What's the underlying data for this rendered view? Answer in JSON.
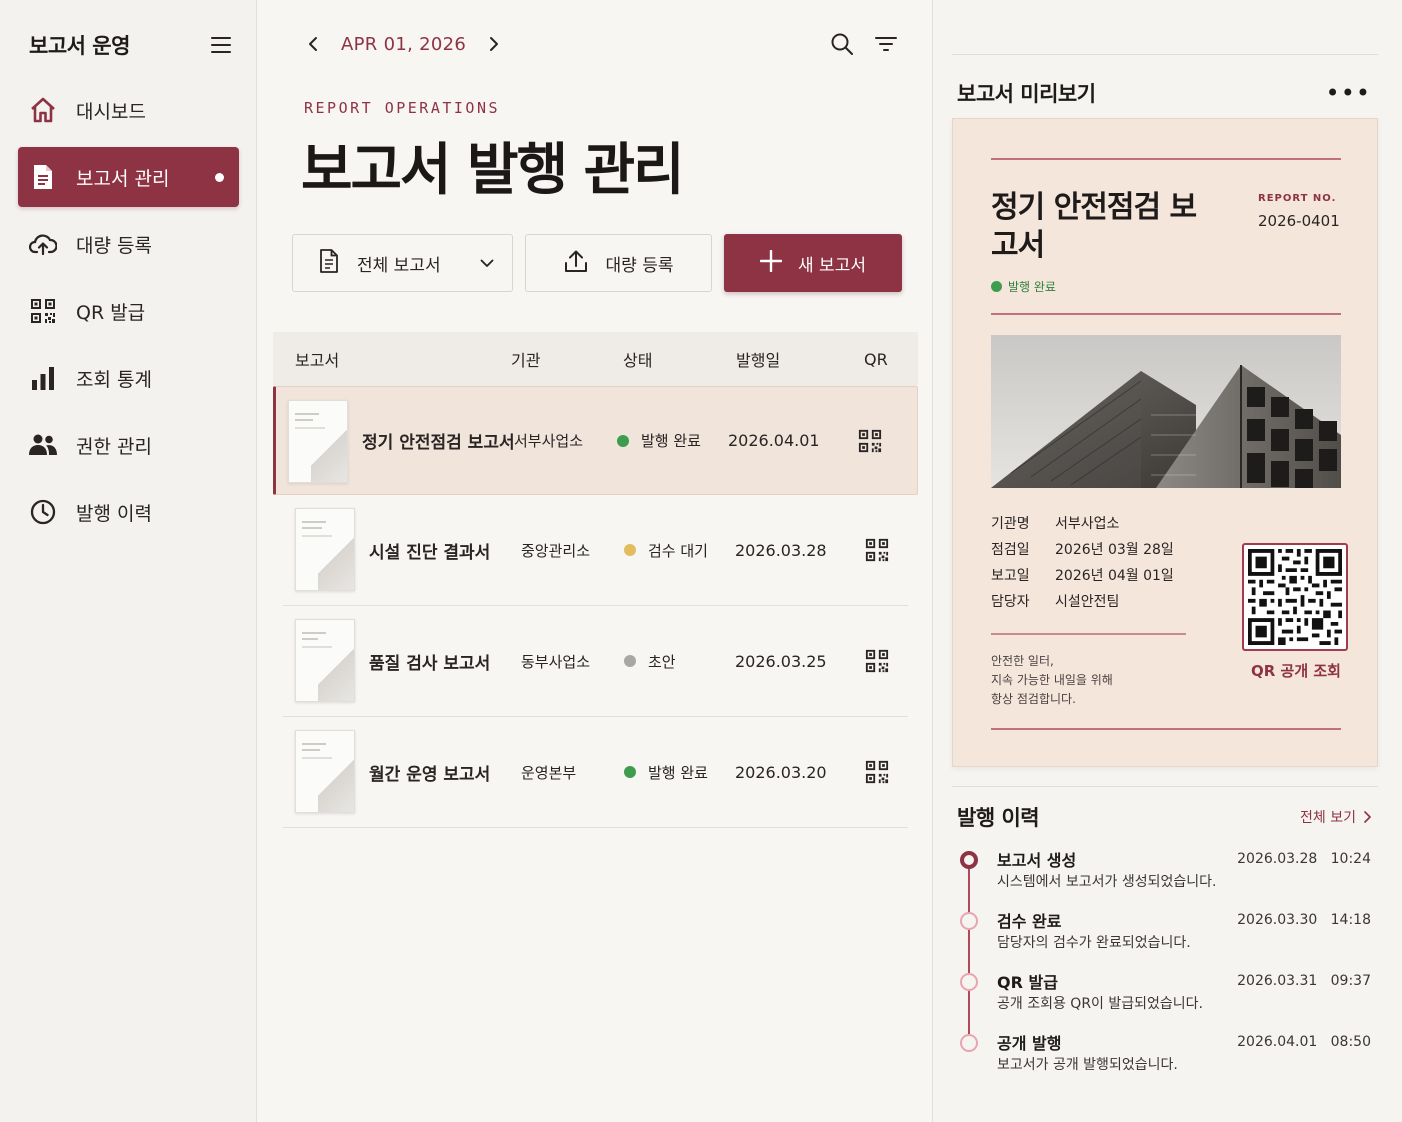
{
  "app": {
    "title": "보고서 운영"
  },
  "sidebar": {
    "items": [
      {
        "label": "대시보드",
        "icon": "home-icon",
        "active": false
      },
      {
        "label": "보고서 관리",
        "icon": "document-icon",
        "active": true
      },
      {
        "label": "대량 등록",
        "icon": "cloud-upload-icon",
        "active": false
      },
      {
        "label": "QR 발급",
        "icon": "qr-code-icon",
        "active": false
      },
      {
        "label": "조회 통계",
        "icon": "bar-chart-icon",
        "active": false
      },
      {
        "label": "권한 관리",
        "icon": "users-icon",
        "active": false
      },
      {
        "label": "발행 이력",
        "icon": "clock-icon",
        "active": false
      }
    ]
  },
  "main": {
    "date": "APR 01, 2026",
    "eyebrow": "REPORT OPERATIONS",
    "title": "보고서 발행 관리",
    "filter_label": "전체 보고서",
    "bulk_label": "대량 등록",
    "new_label": "새 보고서",
    "columns": [
      "보고서",
      "기관",
      "상태",
      "발행일",
      "QR"
    ],
    "rows": [
      {
        "name": "정기 안전점검 보고서",
        "org": "서부사업소",
        "status": "발행 완료",
        "status_color": "#3d9c4d",
        "date": "2026.04.01",
        "selected": true
      },
      {
        "name": "시설 진단 결과서",
        "org": "중앙관리소",
        "status": "검수 대기",
        "status_color": "#e2bc5e",
        "date": "2026.03.28",
        "selected": false
      },
      {
        "name": "품질 검사 보고서",
        "org": "동부사업소",
        "status": "초안",
        "status_color": "#a9a7a5",
        "date": "2026.03.25",
        "selected": false
      },
      {
        "name": "월간 운영 보고서",
        "org": "운영본부",
        "status": "발행 완료",
        "status_color": "#3d9c4d",
        "date": "2026.03.20",
        "selected": false
      }
    ]
  },
  "preview": {
    "title": "보고서 미리보기",
    "card_title": "정기 안전점검 보고서",
    "report_no_label": "REPORT NO.",
    "report_no": "2026-0401",
    "status": "발행 완료",
    "meta": [
      {
        "k": "기관명",
        "v": "서부사업소"
      },
      {
        "k": "점검일",
        "v": "2026년 03월 28일"
      },
      {
        "k": "보고일",
        "v": "2026년 04월 01일"
      },
      {
        "k": "담당자",
        "v": "시설안전팀"
      }
    ],
    "slogan": [
      "안전한 일터,",
      "지속 가능한 내일을 위해",
      "항상 점검합니다."
    ],
    "qr_label": "QR 공개 조회"
  },
  "history": {
    "title": "발행 이력",
    "view_all": "전체 보기",
    "items": [
      {
        "title": "보고서 생성",
        "desc": "시스템에서 보고서가 생성되었습니다.",
        "time": "2026.03.28   10:24"
      },
      {
        "title": "검수 완료",
        "desc": "담당자의 검수가 완료되었습니다.",
        "time": "2026.03.30   14:18"
      },
      {
        "title": "QR 발급",
        "desc": "공개 조회용 QR이 발급되었습니다.",
        "time": "2026.03.31   09:37"
      },
      {
        "title": "공개 발행",
        "desc": "보고서가 공개 발행되었습니다.",
        "time": "2026.04.01   08:50"
      }
    ]
  },
  "colors": {
    "accent": "#8e3344",
    "accent_soft": "#f1e4db",
    "success": "#3d9c4d",
    "pending": "#e2bc5e",
    "draft": "#a9a7a5"
  }
}
